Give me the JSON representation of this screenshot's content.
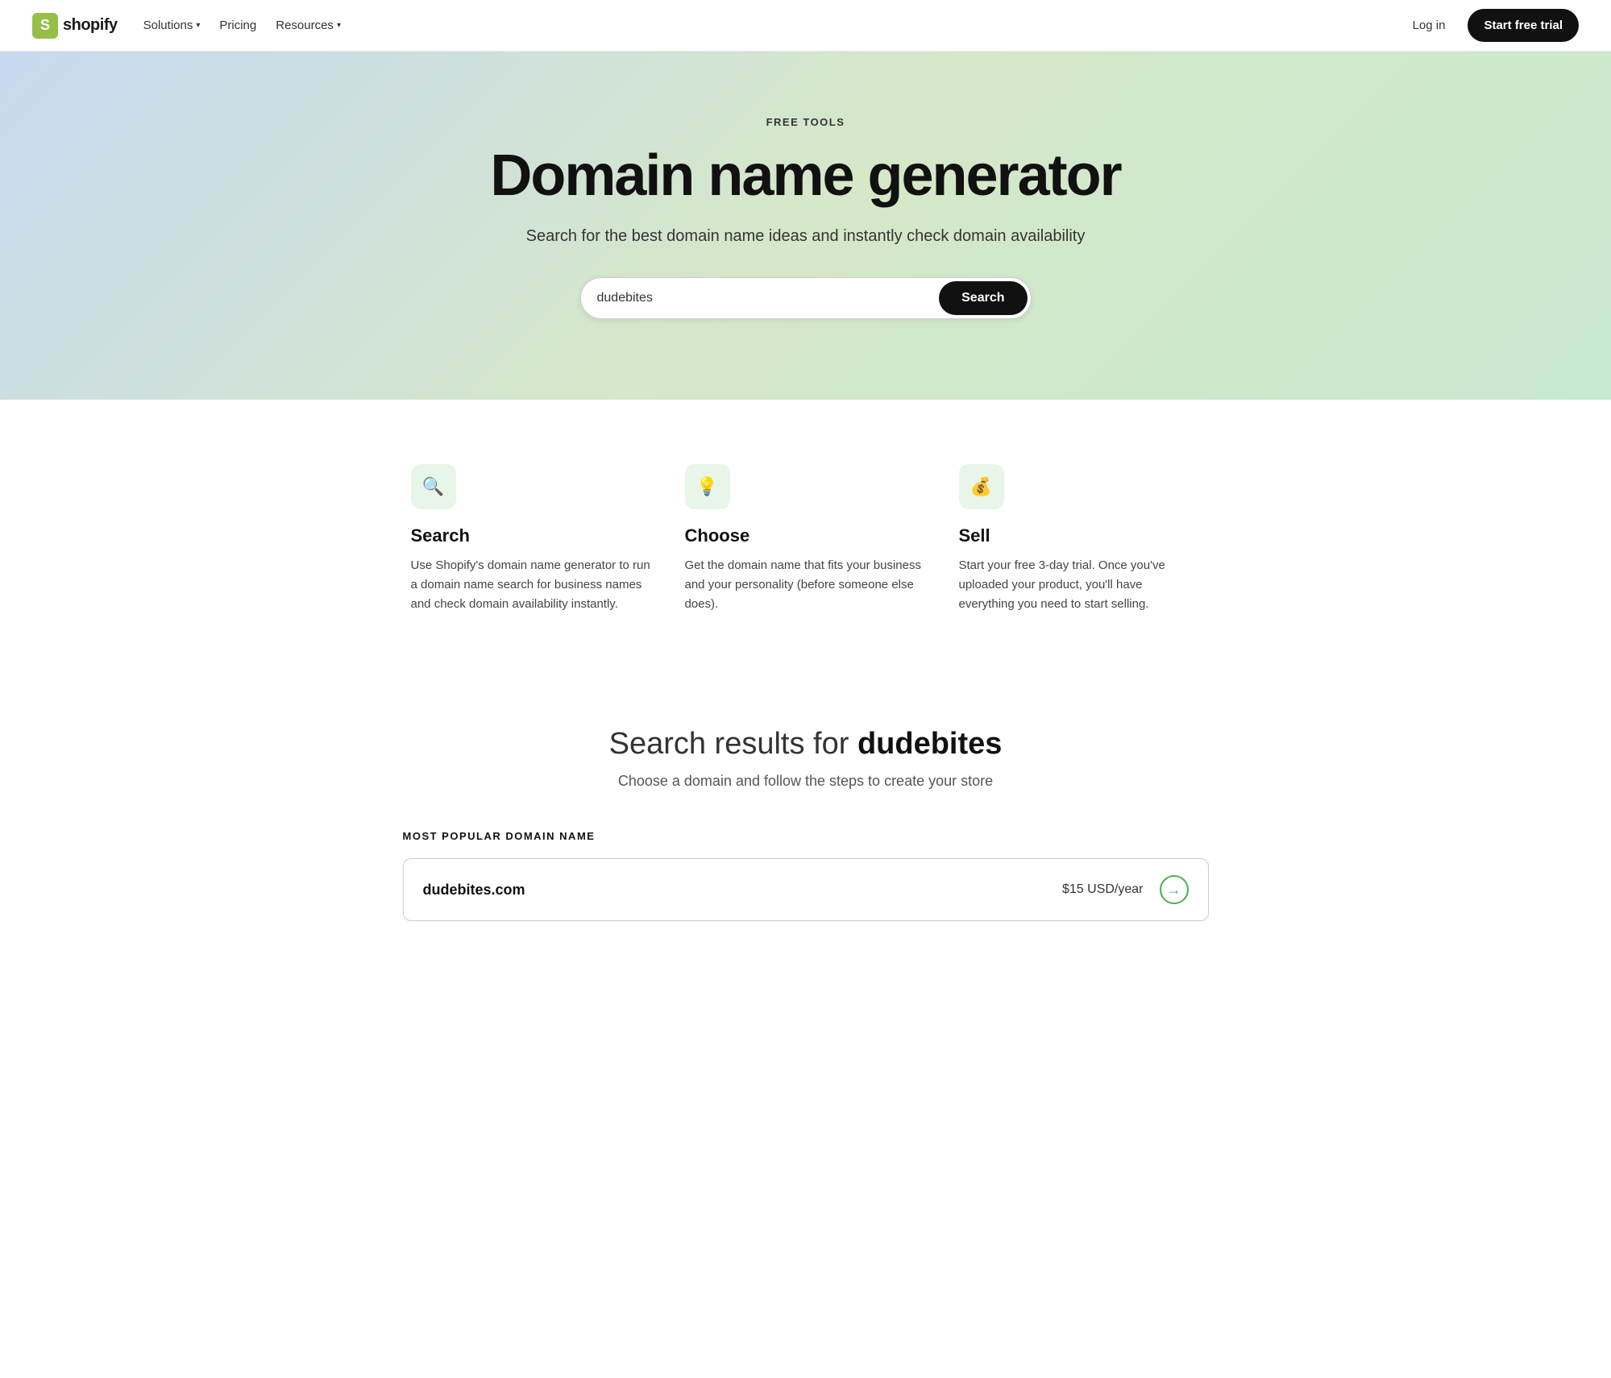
{
  "nav": {
    "logo_text": "shopify",
    "logo_letter": "S",
    "links": [
      {
        "label": "Solutions",
        "has_chevron": true
      },
      {
        "label": "Pricing",
        "has_chevron": false
      },
      {
        "label": "Resources",
        "has_chevron": true
      }
    ],
    "login_label": "Log in",
    "start_trial_label": "Start free trial"
  },
  "hero": {
    "badge": "FREE TOOLS",
    "title": "Domain name generator",
    "subtitle": "Search for the best domain name ideas and instantly check domain availability",
    "search_placeholder": "dudebites",
    "search_button_label": "Search"
  },
  "features": [
    {
      "icon": "🔍",
      "title": "Search",
      "desc": "Use Shopify's domain name generator to run a domain name search for business names and check domain availability instantly."
    },
    {
      "icon": "💡",
      "title": "Choose",
      "desc": "Get the domain name that fits your business and your personality (before someone else does)."
    },
    {
      "icon": "💰",
      "title": "Sell",
      "desc": "Start your free 3-day trial. Once you've uploaded your product, you'll have everything you need to start selling."
    }
  ],
  "results": {
    "heading_prefix": "Search results for ",
    "search_term": "dudebites",
    "subheading": "Choose a domain and follow the steps to create your store",
    "section_label": "MOST POPULAR DOMAIN NAME",
    "domain_result": {
      "name_prefix": "dudebites",
      "tld": ".com",
      "price": "$15 USD/year"
    }
  }
}
